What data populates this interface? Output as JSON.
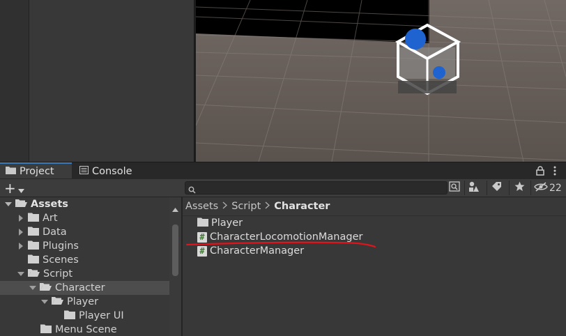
{
  "tabs": {
    "project": "Project",
    "console": "Console"
  },
  "toolbar": {
    "add_symbol": "+",
    "search_value": "",
    "hidden_count": "22"
  },
  "tree": {
    "rows": [
      {
        "label": "Assets",
        "expanded": true,
        "bold": true
      },
      {
        "label": "Art",
        "expanded": false
      },
      {
        "label": "Data",
        "expanded": false
      },
      {
        "label": "Plugins",
        "expanded": false
      },
      {
        "label": "Scenes"
      },
      {
        "label": "Script",
        "expanded": true
      },
      {
        "label": "Character",
        "expanded": true,
        "selected": true
      },
      {
        "label": "Player",
        "expanded": true
      },
      {
        "label": "Player UI"
      },
      {
        "label": "Menu Scene"
      }
    ]
  },
  "breadcrumb": {
    "items": [
      "Assets",
      "Script",
      "Character"
    ]
  },
  "content": {
    "items": [
      {
        "label": "Player",
        "type": "folder"
      },
      {
        "label": "CharacterLocomotionManager",
        "type": "script"
      },
      {
        "label": "CharacterManager",
        "type": "script"
      }
    ],
    "script_glyph": "#"
  },
  "colors": {
    "accent": "#3a79bb",
    "annotation": "#e0141c",
    "panel": "#383838"
  }
}
